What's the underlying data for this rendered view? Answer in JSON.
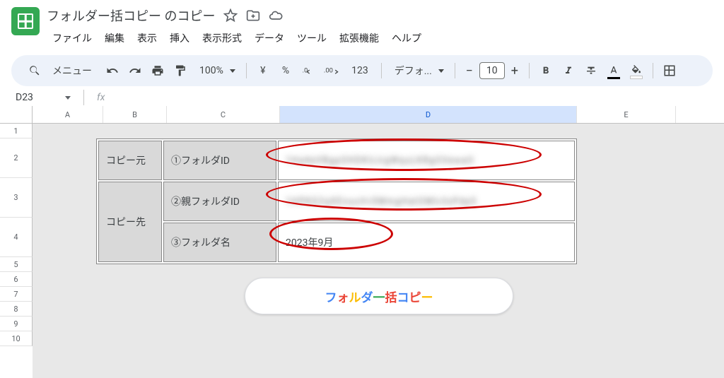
{
  "doc": {
    "title": "フォルダー括コピー のコピー"
  },
  "menu": {
    "file": "ファイル",
    "edit": "編集",
    "view": "表示",
    "insert": "挿入",
    "format": "表示形式",
    "data": "データ",
    "tools": "ツール",
    "extensions": "拡張機能",
    "help": "ヘルプ"
  },
  "toolbar": {
    "menu_label": "メニュー",
    "zoom": "100%",
    "font": "デフォ...",
    "font_size": "10",
    "currency": "¥",
    "percent": "%",
    "dec_less": ".0",
    "dec_more": ".00",
    "numfmt": "123"
  },
  "name_box": "D23",
  "columns": {
    "A": "A",
    "B": "B",
    "C": "C",
    "D": "D",
    "E": "E"
  },
  "widths": {
    "A": 100,
    "B": 90,
    "C": 160,
    "D": 420,
    "E": 140
  },
  "rows": [
    "1",
    "2",
    "3",
    "4",
    "5",
    "6",
    "7",
    "8",
    "9",
    "10"
  ],
  "table": {
    "src_label": "コピー元",
    "dst_label": "コピー先",
    "row1_lbl": "①フォルダID",
    "row2_lbl": "②親フォルダID",
    "row3_lbl": "③フォルダ名",
    "row1_val": "1Ha4eVBgpOHDKUJrgWquLKRgOVewaO",
    "row2_val": "1HPKG2qXEnuuVv5MmgHatOMlv3xPdp5",
    "row3_val": "2023年9月"
  },
  "button": {
    "c1": "フ",
    "c2": "ォ",
    "c3": "ル",
    "c4": "ダ",
    "c5": "一",
    "c6": "括",
    "c7": "コ",
    "c8": "ピ",
    "c9": "ー"
  }
}
